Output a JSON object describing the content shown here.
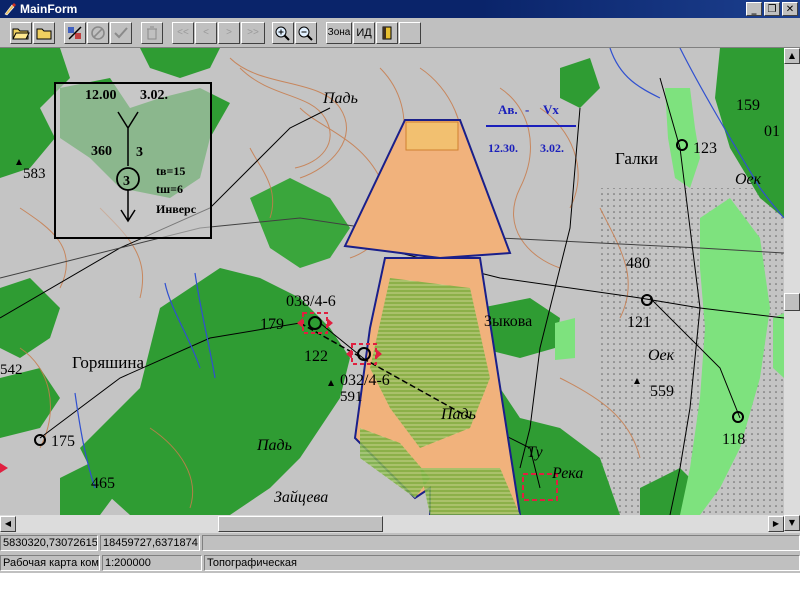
{
  "window": {
    "title": "MainForm",
    "buttons": [
      "_",
      "❐",
      "✕"
    ]
  },
  "toolbar": {
    "zone_label": "Зона",
    "id_label": "ИД"
  },
  "map": {
    "labels": [
      {
        "text": "Падь",
        "name": "pad-north-label"
      },
      {
        "text": "Галки",
        "name": "galki-label"
      },
      {
        "text": "Оек",
        "name": "oek-ne-label"
      },
      {
        "text": "480",
        "name": "height-480-label"
      },
      {
        "text": "159",
        "name": "height-159-label"
      },
      {
        "text": "01",
        "name": "height-01-label"
      },
      {
        "text": "123",
        "name": "point-123-label"
      },
      {
        "text": "583",
        "name": "height-583-label"
      },
      {
        "text": "038/4-6",
        "name": "target-038-label"
      },
      {
        "text": "179",
        "name": "point-179-label"
      },
      {
        "text": "122",
        "name": "point-122-label"
      },
      {
        "text": "032/4-6",
        "name": "target-032-label"
      },
      {
        "text": "591",
        "name": "height-591-label"
      },
      {
        "text": "Зыкова",
        "name": "zykova-label"
      },
      {
        "text": "121",
        "name": "point-121-label"
      },
      {
        "text": "Оек",
        "name": "oek-e-label"
      },
      {
        "text": "559",
        "name": "height-559-label"
      },
      {
        "text": "542",
        "name": "height-542-label"
      },
      {
        "text": "Горяшина",
        "name": "goryashina-label"
      },
      {
        "text": "175",
        "name": "point-175-label"
      },
      {
        "text": "Падь",
        "name": "pad-center-label"
      },
      {
        "text": "Падь",
        "name": "pad-west-label"
      },
      {
        "text": "465",
        "name": "height-465-label"
      },
      {
        "text": "Зайцева",
        "name": "zaytseva-label"
      },
      {
        "text": "Ту",
        "name": "tu-label"
      },
      {
        "text": "Река",
        "name": "reka-label"
      },
      {
        "text": "118",
        "name": "point-118-label"
      }
    ],
    "info_box": {
      "time": "12.00",
      "date": "3.02.",
      "azimuth": "360",
      "count": "3",
      "unit_number": "3",
      "tv": "tв=15",
      "tsh": "tш=6",
      "mode": "Инверс"
    },
    "wind_legend": {
      "av": "Ав.",
      "vx": "Vх",
      "time": "12.30.",
      "date": "3.02."
    }
  },
  "status": {
    "coords_1": "5830320,73072615",
    "coords_2": "18459727,6371874",
    "map_type": "Рабочая карта ком",
    "scale": "1:200000",
    "layer": "Топографическая"
  }
}
